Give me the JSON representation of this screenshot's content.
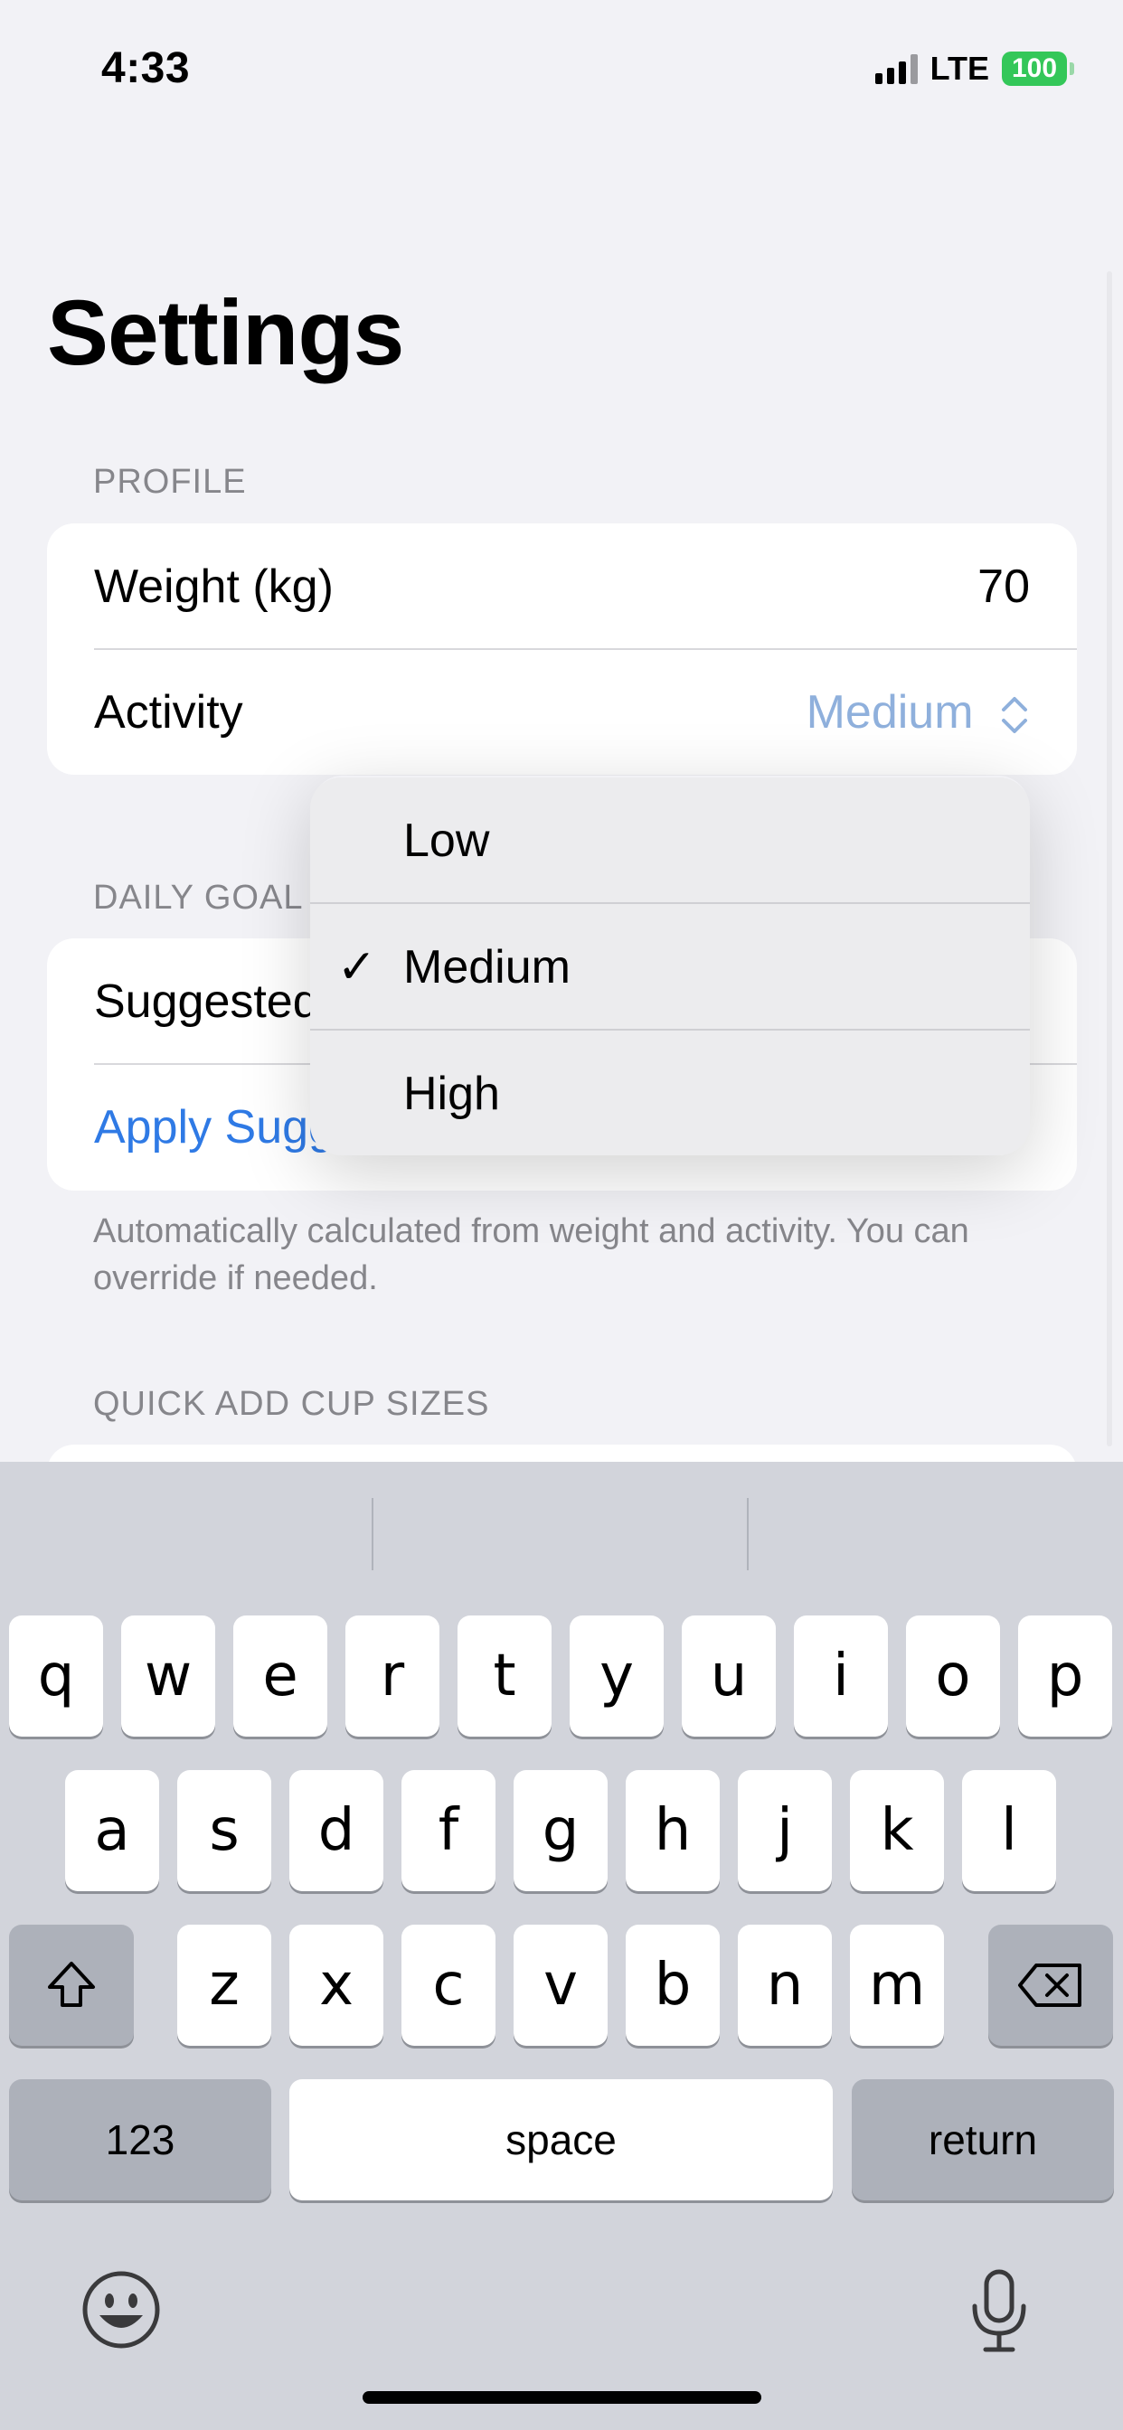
{
  "status_bar": {
    "time": "4:33",
    "network": "LTE",
    "battery": "100"
  },
  "page": {
    "title": "Settings"
  },
  "profile": {
    "header": "PROFILE",
    "weight_label": "Weight (kg)",
    "weight_value": "70",
    "activity_label": "Activity",
    "activity_value": "Medium"
  },
  "daily_goal": {
    "header": "DAILY GOAL",
    "suggested_label": "Suggested",
    "apply_label": "Apply Sugg",
    "footnote": "Automatically calculated from weight and activity. You can override if needed."
  },
  "quick_add": {
    "header": "QUICK ADD CUP SIZES"
  },
  "activity_menu": {
    "options": [
      "Low",
      "Medium",
      "High"
    ],
    "selected": "Medium"
  },
  "keyboard": {
    "row1": [
      "q",
      "w",
      "e",
      "r",
      "t",
      "y",
      "u",
      "i",
      "o",
      "p"
    ],
    "row2": [
      "a",
      "s",
      "d",
      "f",
      "g",
      "h",
      "j",
      "k",
      "l"
    ],
    "row3": [
      "z",
      "x",
      "c",
      "v",
      "b",
      "n",
      "m"
    ],
    "numbers_label": "123",
    "space_label": "space",
    "return_label": "return"
  },
  "colors": {
    "accent": "#2f7ae5",
    "accent_muted": "#8fb0dc",
    "battery": "#34c759"
  }
}
